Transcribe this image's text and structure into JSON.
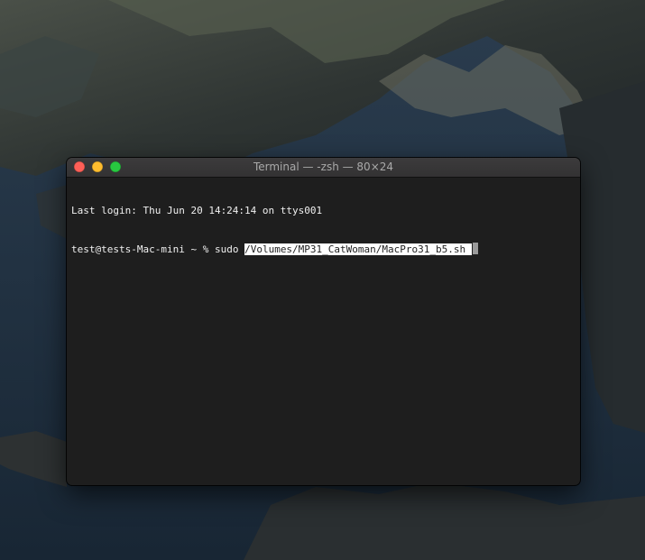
{
  "window": {
    "title": "Terminal — -zsh — 80×24"
  },
  "terminal": {
    "login_line": "Last login: Thu Jun 20 14:24:14 on ttys001",
    "prompt": "test@tests-Mac-mini ~ % ",
    "command": "sudo ",
    "selected_path": "/Volumes/MP31_CatWoman/MacPro31_b5.sh ",
    "text_color": "#f0f0f0",
    "background_color": "#1e1e1e"
  },
  "buttons": {
    "close_icon": "close-icon",
    "minimize_icon": "minimize-icon",
    "zoom_icon": "zoom-icon",
    "close_color": "#ff5f57",
    "minimize_color": "#febc2e",
    "zoom_color": "#28c840"
  }
}
